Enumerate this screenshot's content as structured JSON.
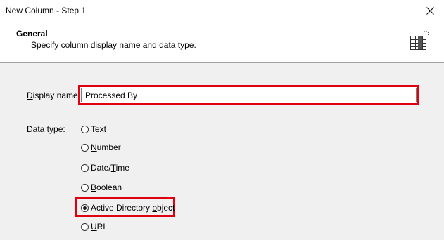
{
  "window": {
    "title": "New Column - Step 1"
  },
  "header": {
    "title": "General",
    "subtitle": "Specify column display name and data type.",
    "icon": "column-table-icon"
  },
  "display_name": {
    "label_hotkey": "D",
    "label_rest": "isplay name:",
    "value": "Processed By"
  },
  "data_type": {
    "label": "Data type:",
    "options": [
      {
        "hotkey": "T",
        "rest": "ext",
        "checked": false
      },
      {
        "hotkey": "N",
        "rest": "umber",
        "checked": false
      },
      {
        "pre": "Date/",
        "hotkey": "T",
        "rest": "ime",
        "checked": false
      },
      {
        "hotkey": "B",
        "rest": "oolean",
        "checked": false
      },
      {
        "pre": "Active Directory ",
        "hotkey": "o",
        "rest": "bject",
        "checked": true
      },
      {
        "hotkey": "U",
        "rest": "RL",
        "checked": false
      }
    ]
  },
  "colors": {
    "highlight": "#e0000f"
  }
}
